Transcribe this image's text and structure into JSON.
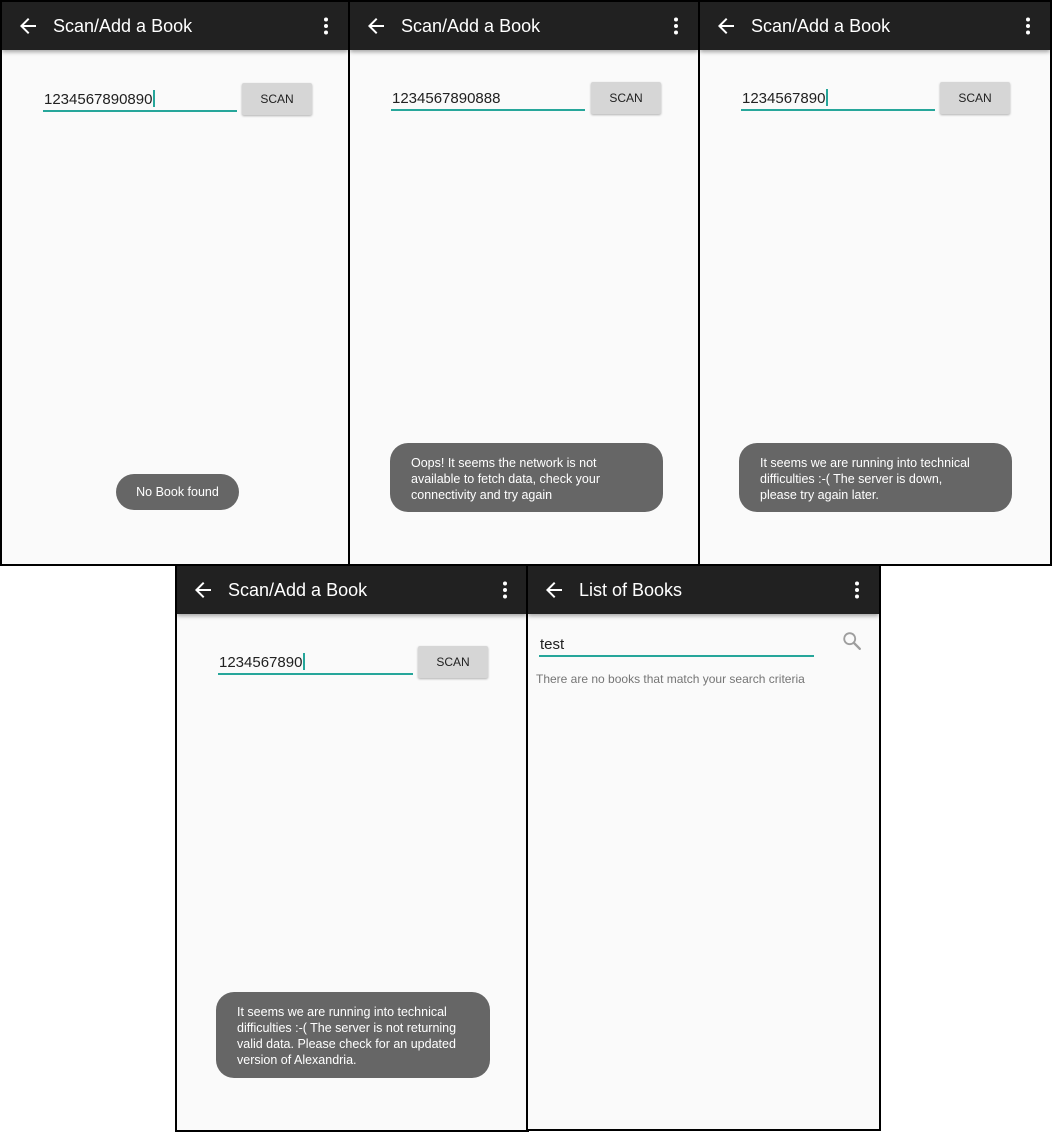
{
  "screens": [
    {
      "title": "Scan/Add a Book",
      "isbn_value": "1234567890890",
      "scan_label": "SCAN",
      "toast": "No Book found"
    },
    {
      "title": "Scan/Add a Book",
      "isbn_value": "1234567890888",
      "scan_label": "SCAN",
      "toast": "Oops! It seems the network is not available to fetch data, check your connectivity and try again"
    },
    {
      "title": "Scan/Add a Book",
      "isbn_value": "1234567890",
      "scan_label": "SCAN",
      "toast": "It seems we are running into technical difficulties :-( The server is down, please try again later."
    },
    {
      "title": "Scan/Add a Book",
      "isbn_value": "1234567890",
      "scan_label": "SCAN",
      "toast": "It seems we are running into technical difficulties :-( The server is not returning valid data. Please check for an updated version of Alexandria."
    },
    {
      "title": "List of Books",
      "search_value": "test",
      "empty_message": "There are no books that match your search criteria"
    }
  ],
  "icons": {
    "back": "arrow-back-icon",
    "more": "more-vert-icon",
    "search": "search-icon"
  },
  "colors": {
    "toolbar": "#212121",
    "accent": "#26a69a",
    "toast": "#666666",
    "button": "#d6d6d6",
    "background": "#fafafa"
  }
}
